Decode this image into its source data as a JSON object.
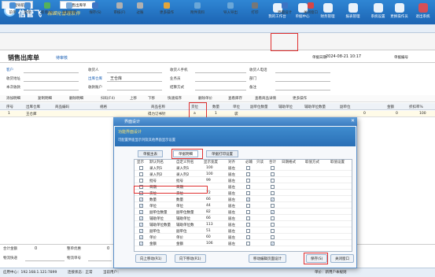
{
  "app": {
    "name": "信管飞",
    "subtitle": "精细化管理软件"
  },
  "header_nav": [
    "我的工作台",
    "单据中心",
    "财务管理",
    "报表管理",
    "系统设置",
    "更换操作员",
    "退出系统"
  ],
  "tabs": [
    "功能导航",
    "销售出库单"
  ],
  "toolbar": [
    "前单",
    "后单",
    "新增(N)",
    "复制新增",
    "保存(S)",
    "审核(F)",
    "过账",
    "打印",
    "更多操作",
    "附件资料",
    "导入导出",
    "打印",
    "界面设计",
    "关闭窗口"
  ],
  "page": {
    "title": "销售出库单",
    "badge": "待审核",
    "date_label": "单据日期",
    "date": "2024-08-21 10:17",
    "ordno_label": "单据编号"
  },
  "form": {
    "customer": "客户",
    "warehouse_label": "出库仓库",
    "warehouse": "王仓库",
    "receiver": "收货人",
    "receiver_phone": "收货人手机",
    "receiver_tel": "收货人电话",
    "address": "收货地址",
    "salesman": "业务员",
    "dept": "部门",
    "collect": "本次收款",
    "account": "收款账户",
    "settle": "结算方式",
    "remark": "备注"
  },
  "sec_toolbar": [
    "添加明细",
    "复制明细",
    "删除明细",
    "扫码(F4)",
    "上移",
    "下移",
    "快速排序",
    "删除单价",
    "查看库存",
    "查看商品详情",
    "更多操作"
  ],
  "grid_headers": [
    "序号",
    "出库仓库",
    "商品编码",
    "规格",
    "商品名称",
    "货位",
    "数量",
    "单位",
    "副单位数量",
    "辅助单位",
    "辅助单位数量",
    "副单位",
    "金额",
    "折扣率%"
  ],
  "grid_row": {
    "no": "1",
    "wh": "王仓库",
    "name": "得力订书针",
    "huowei": "a",
    "qty": "1",
    "unit": "袋",
    "zero": "0",
    "amount": "0",
    "rate": "100"
  },
  "bottom": {
    "total": "合计金额",
    "total_val": "0",
    "discount": "整单优惠",
    "discount_val": "0",
    "logistics": "物流快递",
    "track": "物流单号"
  },
  "status": {
    "ip": "应用中心：192.168.1.121:7899",
    "conn": "连接状态：正常",
    "user": "当前用户：",
    "version": "单价：新用户本规则"
  },
  "dialog": {
    "title": "界面设计",
    "banner_title": "功能界面设计",
    "banner_sub": "可配置界面显示列及其他界面显示设置",
    "tabs": [
      "单据主表",
      "单据明细",
      "单据打印设置"
    ],
    "headers": [
      "显示",
      "默认列名",
      "自定义列名",
      "显示宽度",
      "对齐",
      "必输",
      "只读",
      "合计",
      "日期格式",
      "取值方式",
      "取值设置"
    ],
    "rows": [
      {
        "show": "",
        "def": "录入列1",
        "cus": "录入列1",
        "w": "100",
        "align": "居左",
        "req": "",
        "sum": ""
      },
      {
        "show": "",
        "def": "录入列2",
        "cus": "录入列2",
        "w": "100",
        "align": "居左",
        "req": "",
        "sum": ""
      },
      {
        "show": "",
        "def": "批号",
        "cus": "批号",
        "w": "99",
        "align": "居左",
        "req": "",
        "sum": ""
      },
      {
        "show": "",
        "def": "日期",
        "cus": "日期",
        "w": "",
        "align": "居左",
        "req": "",
        "sum": ""
      },
      {
        "show": "✓",
        "def": "货位",
        "cus": "货位",
        "w": "72",
        "align": "居左",
        "req": "",
        "sum": ""
      },
      {
        "show": "✓",
        "def": "数量",
        "cus": "数量",
        "w": "66",
        "align": "居左",
        "req": "✓",
        "sum": "✓"
      },
      {
        "show": "✓",
        "def": "单位",
        "cus": "单位",
        "w": "44",
        "align": "居左",
        "req": "",
        "sum": ""
      },
      {
        "show": "✓",
        "def": "副单位数量",
        "cus": "副单位数量",
        "w": "82",
        "align": "居左",
        "req": "",
        "sum": "✓"
      },
      {
        "show": "✓",
        "def": "辅助单位",
        "cus": "辅助单位",
        "w": "66",
        "align": "居左",
        "req": "",
        "sum": ""
      },
      {
        "show": "✓",
        "def": "辅助单位数量",
        "cus": "辅助单位数",
        "w": "113",
        "align": "居左",
        "req": "",
        "sum": ""
      },
      {
        "show": "✓",
        "def": "副单位",
        "cus": "副单位",
        "w": "51",
        "align": "居左",
        "req": "",
        "sum": ""
      },
      {
        "show": "✓",
        "def": "单价",
        "cus": "单价",
        "w": "60",
        "align": "居左",
        "req": "",
        "sum": ""
      },
      {
        "show": "✓",
        "def": "金额",
        "cus": "金额",
        "w": "106",
        "align": "居左",
        "req": "",
        "sum": "✓"
      }
    ],
    "buttons": [
      "向上移动(R1)",
      "向下移动(R1)",
      "移动编辑页面设计",
      "保存(S)",
      "关闭窗口"
    ]
  }
}
